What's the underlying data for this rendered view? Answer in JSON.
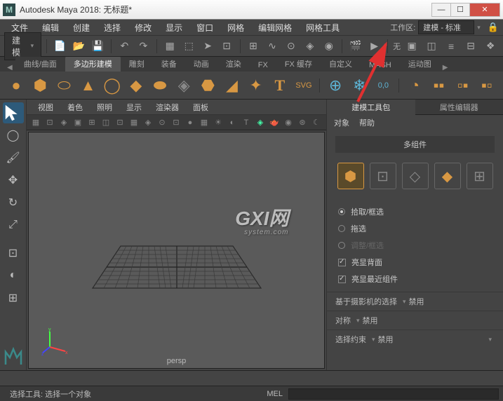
{
  "window": {
    "title": "Autodesk Maya 2018: 无标题*",
    "logo_letter": "M"
  },
  "menubar": {
    "items": [
      "文件",
      "编辑",
      "创建",
      "选择",
      "修改",
      "显示",
      "窗口",
      "网格",
      "编辑网格",
      "网格工具"
    ],
    "workspace_label": "工作区:",
    "workspace_value": "建模 - 标准"
  },
  "module_select": "建模",
  "shelf_tabs": {
    "items": [
      "曲线/曲面",
      "多边形建模",
      "雕刻",
      "装备",
      "动画",
      "渲染",
      "FX",
      "FX 缓存",
      "自定义",
      "MASH",
      "运动图"
    ],
    "active": 1
  },
  "shelf_icons": [
    "sphere",
    "cube",
    "cylinder",
    "cone",
    "torus",
    "plane",
    "disc",
    "prism",
    "pyramid",
    "pipe",
    "helix",
    "gear",
    "star",
    "type",
    "svg",
    "aim",
    "freeze",
    "snow",
    "layer",
    "bool1",
    "bool2",
    "bool3"
  ],
  "panel_menu": [
    "视图",
    "着色",
    "照明",
    "显示",
    "渲染器",
    "面板"
  ],
  "view_label": "persp",
  "watermark": {
    "main": "GXI网",
    "sub": "system.com"
  },
  "right_panel": {
    "tabs": [
      "建模工具包",
      "属性编辑器"
    ],
    "menu": [
      "对象",
      "帮助"
    ],
    "section_title": "多组件",
    "options": {
      "pick": "拾取/框选",
      "drag": "拖选",
      "tweak": "调整/框选",
      "highlight_back": "亮显背面",
      "highlight_near": "亮显最近组件"
    },
    "props": {
      "camera_sel": "基于摄影机的选择",
      "symmetry": "对称",
      "constraint": "选择约束",
      "disabled": "禁用"
    }
  },
  "status": {
    "text": "选择工具: 选择一个对象",
    "cmd_label": "MEL"
  }
}
